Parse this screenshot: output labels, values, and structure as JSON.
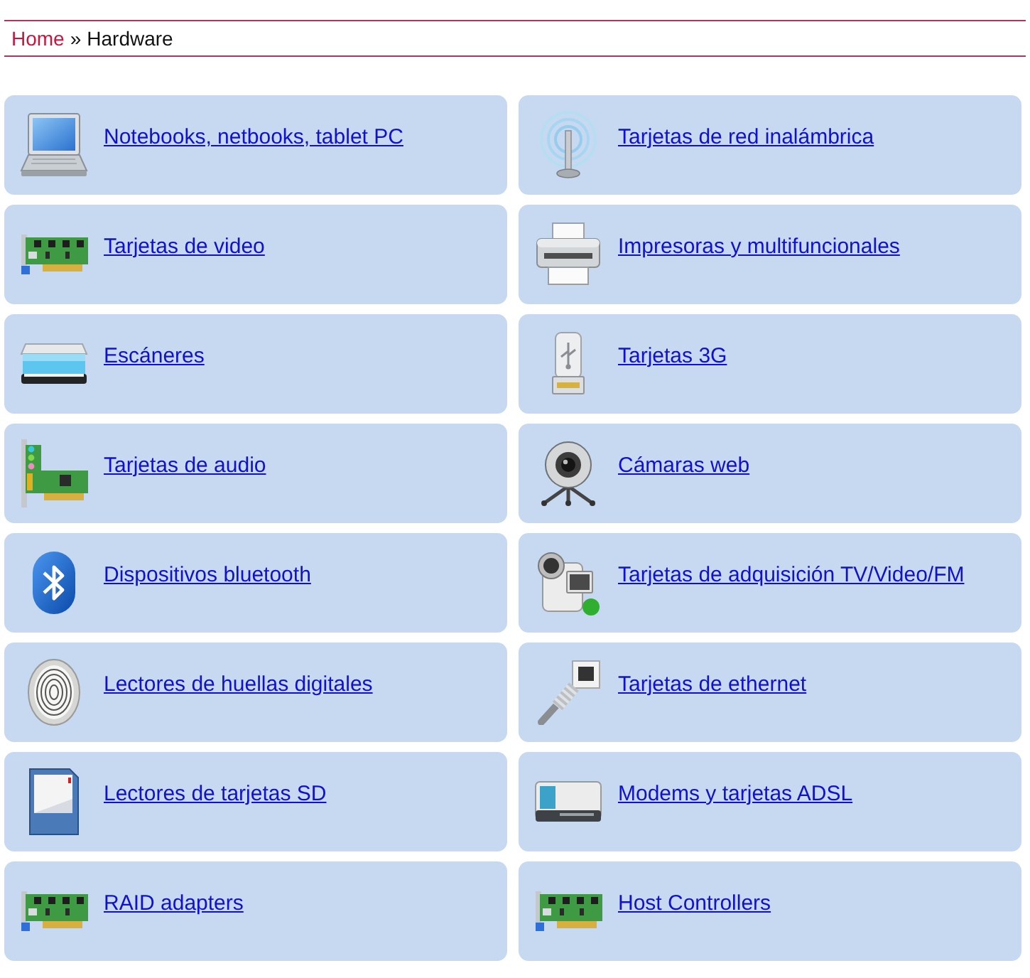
{
  "breadcrumb": [
    {
      "kind": "link",
      "label": "Home"
    },
    {
      "kind": "separator",
      "label": "»"
    },
    {
      "kind": "current",
      "label": "Hardware"
    }
  ],
  "categories": [
    {
      "label": "Notebooks, netbooks, tablet PC",
      "kind": "laptop"
    },
    {
      "label": "Tarjetas de red inalámbrica",
      "kind": "antenna"
    },
    {
      "label": "Tarjetas de video",
      "kind": "expansion-card"
    },
    {
      "label": "Impresoras y multifuncionales",
      "kind": "printer"
    },
    {
      "label": "Escáneres",
      "kind": "scanner"
    },
    {
      "label": "Tarjetas 3G",
      "kind": "usb-plug"
    },
    {
      "label": "Tarjetas de audio",
      "kind": "sound-card"
    },
    {
      "label": "Cámaras web",
      "kind": "webcam"
    },
    {
      "label": "Dispositivos bluetooth",
      "kind": "bluetooth"
    },
    {
      "label": "Tarjetas de adquisición TV/Video/FM",
      "kind": "camcorder"
    },
    {
      "label": "Lectores de huellas digitales",
      "kind": "fingerprint"
    },
    {
      "label": "Tarjetas de ethernet",
      "kind": "ethernet"
    },
    {
      "label": "Lectores de tarjetas SD",
      "kind": "sd-card"
    },
    {
      "label": "Modems y tarjetas ADSL",
      "kind": "modem"
    },
    {
      "label": "RAID adapters",
      "kind": "expansion-card"
    },
    {
      "label": "Host Controllers",
      "kind": "expansion-card"
    }
  ]
}
